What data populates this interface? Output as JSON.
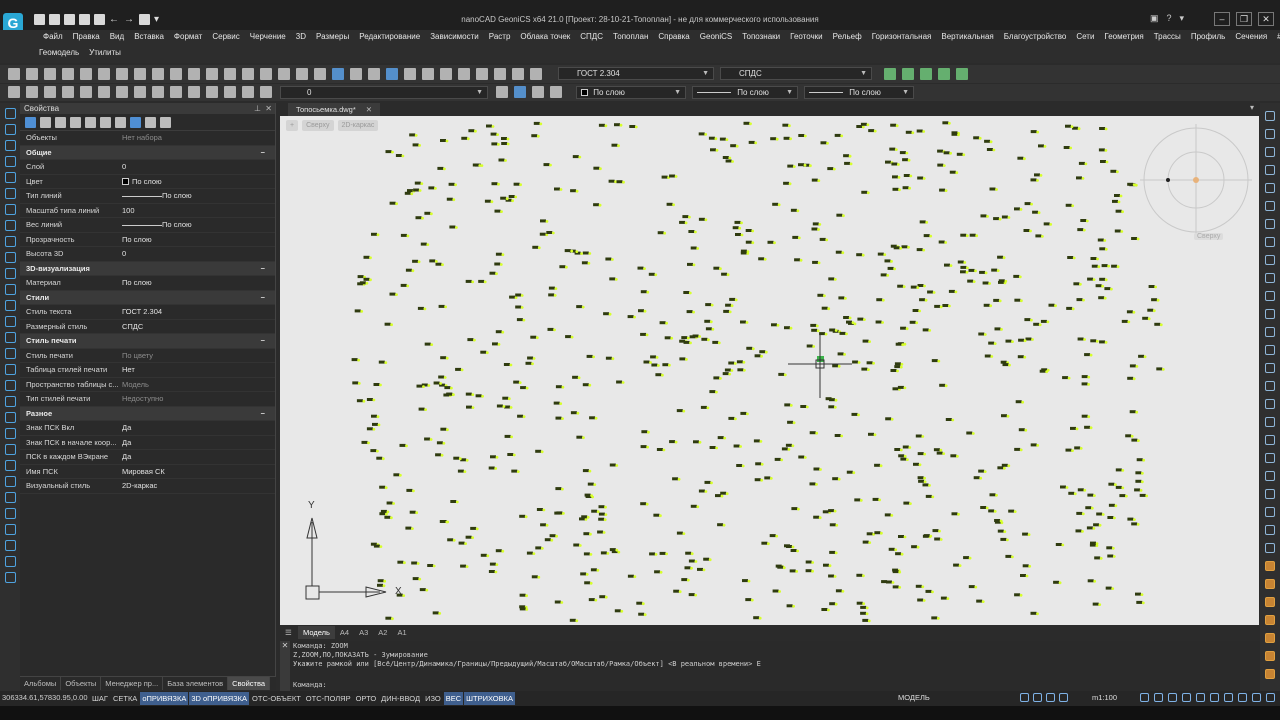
{
  "window": {
    "title": "nanoCAD GeoniCS x64 21.0 [Проект: 28-10-21-Топоплан] - не для коммерческого использования",
    "logo": "G"
  },
  "menu": {
    "row1": [
      "Файл",
      "Правка",
      "Вид",
      "Вставка",
      "Формат",
      "Сервис",
      "Черчение",
      "3D",
      "Размеры",
      "Редактирование",
      "Зависимости",
      "Растр",
      "Облака точек",
      "СПДС",
      "Топоплан",
      "Справка",
      "GeoniCS",
      "Топознаки",
      "Геоточки",
      "Рельеф",
      "Горизонтальная",
      "Вертикальная",
      "Благоустройство",
      "Сети",
      "Геометрия",
      "Трассы",
      "Профиль",
      "Сечения",
      "# Коридоры"
    ],
    "row2": [
      "Геомодель",
      "Утилиты"
    ]
  },
  "toolbar": {
    "text_style": "ГОСТ 2.304",
    "dim_style": "СПДС",
    "layer": "0",
    "color": "По слою",
    "linetype": "По слою",
    "lineweight": "По слою"
  },
  "props": {
    "title": "Свойства",
    "rows": [
      {
        "k": "Объекты",
        "v": "Нет набора",
        "vdim": true
      },
      {
        "section": "Общие"
      },
      {
        "k": "Слой",
        "v": "0"
      },
      {
        "k": "Цвет",
        "v": "По слою"
      },
      {
        "k": "Тип линий",
        "v": "По слою"
      },
      {
        "k": "Масштаб типа линий",
        "v": "100"
      },
      {
        "k": "Вес линий",
        "v": "По слою"
      },
      {
        "k": "Прозрачность",
        "v": "По слою"
      },
      {
        "k": "Высота 3D",
        "v": "0"
      },
      {
        "section": "3D-визуализация"
      },
      {
        "k": "Материал",
        "v": "По слою"
      },
      {
        "section": "Стили"
      },
      {
        "k": "Стиль текста",
        "v": "ГОСТ 2.304"
      },
      {
        "k": "Размерный стиль",
        "v": "СПДС"
      },
      {
        "section": "Стиль печати"
      },
      {
        "k": "Стиль печати",
        "v": "По цвету",
        "vdim": true
      },
      {
        "k": "Таблица стилей печати",
        "v": "Нет"
      },
      {
        "k": "Пространство таблицы с...",
        "v": "Модель",
        "vdim": true
      },
      {
        "k": "Тип стилей печати",
        "v": "Недоступно",
        "vdim": true
      },
      {
        "section": "Разное"
      },
      {
        "k": "Знак ПСК Вкл",
        "v": "Да"
      },
      {
        "k": "Знак ПСК в начале коор...",
        "v": "Да"
      },
      {
        "k": "ПСК в каждом ВЭкране",
        "v": "Да"
      },
      {
        "k": "Имя ПСК",
        "v": "Мировая СК"
      },
      {
        "k": "Визуальный стиль",
        "v": "2D-каркас"
      }
    ],
    "tabs": [
      "Альбомы",
      "Объекты",
      "Менеджер пр...",
      "База элементов",
      "Свойства"
    ],
    "active_tab": "Свойства"
  },
  "document": {
    "tab_name": "Топосьемка.dwg*",
    "view_labels": [
      "+",
      "Сверху",
      "2D-каркас"
    ],
    "compass_label": "Сверху",
    "ucs_y": "Y",
    "ucs_x": "X"
  },
  "layouts": [
    "Модель",
    "А4",
    "А3",
    "А2",
    "А1"
  ],
  "active_layout": "Модель",
  "command": {
    "lines": [
      "Команда: ZOOM",
      "Z,ZOOM,ПО,ПОКАЗАТЬ - Зумирование",
      "Укажите рамкой или [Всё/Центр/Динамика/Границы/Предыдущий/Масштаб/ОМасштаб/Рамка/Объект] <В реальном времени> E",
      "Команда:"
    ]
  },
  "status": {
    "coords": "306334.61,57830.95,0.00",
    "buttons": [
      {
        "label": "ШАГ",
        "on": false
      },
      {
        "label": "СЕТКА",
        "on": false
      },
      {
        "label": "оПРИВЯЗКА",
        "on": true
      },
      {
        "label": "3D оПРИВЯЗКА",
        "on": true
      },
      {
        "label": "ОТС-ОБЪЕКТ",
        "on": false
      },
      {
        "label": "ОТС-ПОЛЯР",
        "on": false
      },
      {
        "label": "ОРТО",
        "on": false
      },
      {
        "label": "ДИН-ВВОД",
        "on": false
      },
      {
        "label": "ИЗО",
        "on": false
      },
      {
        "label": "ВЕС",
        "on": true
      },
      {
        "label": "ШТРИХОВКА",
        "on": true
      }
    ],
    "model": "МОДЕЛЬ",
    "scale": "m1:100"
  },
  "colors": {
    "canvas": "#e8e8e8",
    "point_mark": "#2f3b10",
    "point_dot": "#d7ff2a",
    "accent": "#3f5f8e"
  }
}
